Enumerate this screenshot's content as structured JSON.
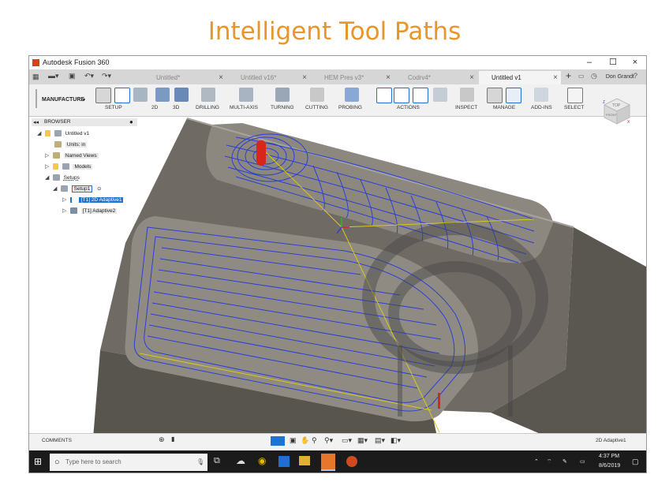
{
  "slide": {
    "title": "Intelligent Tool Paths"
  },
  "window": {
    "title": "Autodesk Fusion 360",
    "minimize": "–",
    "maximize": "☐",
    "close": "×"
  },
  "tabs": [
    {
      "label": "Untitled*",
      "active": false
    },
    {
      "label": "Untitled v16*",
      "active": false
    },
    {
      "label": "HEM Pres v3*",
      "active": false
    },
    {
      "label": "Codrv4*",
      "active": false
    },
    {
      "label": "Untitled v1",
      "active": true
    }
  ],
  "user": {
    "name": "Don Grandt"
  },
  "toolbar": {
    "workspace": "MANUFACTURE",
    "groups": [
      "SETUP",
      "2D",
      "3D",
      "DRILLING",
      "MULTI-AXIS",
      "TURNING",
      "CUTTING",
      "PROBING",
      "ACTIONS",
      "INSPECT",
      "MANAGE",
      "ADD-INS",
      "SELECT"
    ]
  },
  "browser": {
    "header": "BROWSER",
    "items": [
      {
        "label": "Untitled v1"
      },
      {
        "label": "Units: in"
      },
      {
        "label": "Named Views"
      },
      {
        "label": "Models"
      },
      {
        "label": "Setups"
      },
      {
        "label": "Setup1"
      },
      {
        "label": "[T1] 2D Adaptive1"
      },
      {
        "label": "[T1] Adaptive2"
      }
    ]
  },
  "viewcube": {
    "top": "TOP",
    "front": "FRONT",
    "axis_x": "X",
    "axis_z": "Z"
  },
  "bottom": {
    "comments": "COMMENTS",
    "status": "2D Adaptive1"
  },
  "taskbar": {
    "search_placeholder": "Type here to search",
    "time": "4:37 PM",
    "date": "8/6/2019"
  },
  "colors": {
    "title": "#e8962b",
    "toolpath_blue": "#2b3fd6",
    "toolpath_yellow": "#d8c81e",
    "part_gray": "#7b7770",
    "selection": "#1f74d1"
  }
}
